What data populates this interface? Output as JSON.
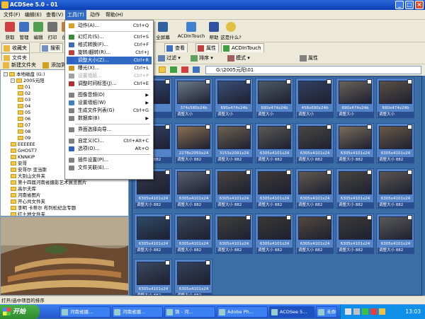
{
  "window": {
    "title": "ACDSee 5.0 - 01"
  },
  "menubar": [
    "文件(F)",
    "编辑(E)",
    "查看(V)",
    "工具(T)",
    "动作",
    "帮助(H)"
  ],
  "toolbar": [
    "获取",
    "管理",
    "编辑",
    "打印",
    "创建",
    "全屏幕",
    "ACDInTouch",
    "帮助",
    "这是什么?"
  ],
  "left": {
    "tabs": [
      "收藏夹",
      "搜索",
      "文件夹"
    ],
    "actions": [
      "新建文件夹",
      "添加到收"
    ],
    "tree": [
      {
        "label": "本地磁盘 (G:)",
        "indent": 0,
        "expand": "-"
      },
      {
        "label": "2005元阳",
        "indent": 1,
        "expand": "-"
      },
      {
        "label": "01",
        "indent": 2
      },
      {
        "label": "02",
        "indent": 2
      },
      {
        "label": "03",
        "indent": 2
      },
      {
        "label": "04",
        "indent": 2
      },
      {
        "label": "05",
        "indent": 2
      },
      {
        "label": "06",
        "indent": 2
      },
      {
        "label": "07",
        "indent": 2
      },
      {
        "label": "08",
        "indent": 2
      },
      {
        "label": "09",
        "indent": 2
      },
      {
        "label": "EEEEEE",
        "indent": 1
      },
      {
        "label": "GHOST7",
        "indent": 1
      },
      {
        "label": "KNNKIP",
        "indent": 1
      },
      {
        "label": "安哥",
        "indent": 1
      },
      {
        "label": "安哥尔 亚当斯",
        "indent": 1
      },
      {
        "label": "大别山文件夹",
        "indent": 1
      },
      {
        "label": "第十四届河南省摄影艺术展览图片",
        "indent": 1
      },
      {
        "label": "高尔夫库",
        "indent": 1
      },
      {
        "label": "河南省图片",
        "indent": 1
      },
      {
        "label": "开心共文件夹",
        "indent": 1
      },
      {
        "label": "李明 卡蒂尔 布列松纪念专题",
        "indent": 1
      },
      {
        "label": "红土地文件夹",
        "indent": 1
      }
    ]
  },
  "right": {
    "tabs": [
      "查看",
      "属性",
      "ACDInTouch"
    ],
    "toolbar": [
      "过滤",
      "排序",
      "模式",
      "属性"
    ],
    "address": "G:\\2005元阳\\01"
  },
  "tools_menu": {
    "items": [
      {
        "label": "动作(A)...",
        "shortcut": "Ctrl+Q",
        "sep_after": true,
        "icon": "action-icon",
        "color": "#e0a020"
      },
      {
        "label": "幻灯片(S)...",
        "shortcut": "Ctrl+S",
        "icon": "slideshow-icon",
        "color": "#3a8a3a"
      },
      {
        "label": "格式转换(F)...",
        "shortcut": "Ctrl+F",
        "icon": "convert-icon",
        "color": "#406ab0"
      },
      {
        "label": "旋转/翻转(R)...",
        "shortcut": "Ctrl+J",
        "icon": "rotate-icon",
        "color": "#c04040"
      },
      {
        "label": "调整大小(Z)...",
        "shortcut": "Ctrl+R",
        "selected": true,
        "icon": "resize-icon",
        "color": "#3060c0"
      },
      {
        "label": "曝光(X)...",
        "shortcut": "Ctrl+L",
        "icon": "exposure-icon",
        "color": "#d09020"
      },
      {
        "label": "设置墙纸...",
        "shortcut": "Ctrl+P",
        "disabled": true,
        "icon": "wallpaper-icon",
        "color": "#a0a0a0"
      },
      {
        "label": "调整时间标签(J)...",
        "shortcut": "Ctrl+E",
        "sep_after": true,
        "icon": "timestamp-icon",
        "color": "#b03030"
      },
      {
        "label": "图像音频(D)",
        "arrow": "▶",
        "icon": "audio-icon",
        "color": "#808080"
      },
      {
        "label": "设置墙纸(W)",
        "arrow": "▶",
        "icon": "wallpaper-icon",
        "color": "#4080c0"
      },
      {
        "label": "生成文件列表(G)",
        "shortcut": "Ctrl+G",
        "icon": "filelist-icon",
        "color": "#808080"
      },
      {
        "label": "数据库(B)",
        "arrow": "▶",
        "sep_after": true,
        "icon": "database-icon",
        "color": "#808080"
      },
      {
        "label": "界面选择向导...",
        "sep_after": true,
        "icon": "wizard-icon",
        "color": "#808080"
      },
      {
        "label": "自定义(C)...",
        "shortcut": "Ctrl+Alt+C",
        "icon": "customize-icon",
        "color": "#808080"
      },
      {
        "label": "选项(O)...",
        "shortcut": "Alt+O",
        "sep_after": true,
        "icon": "options-icon",
        "color": "#3060c0"
      },
      {
        "label": "插件设置(P)...",
        "icon": "plugin-icon",
        "color": "#808080"
      },
      {
        "label": "文件关联(E)...",
        "icon": "association-icon",
        "color": "#808080"
      }
    ]
  },
  "thumbnails": [
    {
      "cap1": "",
      "cap2": "调整大小",
      "tone": "#2f4a7a"
    },
    {
      "cap1": "374x580x24b",
      "cap2": "调整大小",
      "tone": "#6a7a8a"
    },
    {
      "cap1": "690x474x24b",
      "cap2": "调整大小",
      "tone": "#3a4f78"
    },
    {
      "cap1": "690x474x24b",
      "cap2": "调整大小",
      "tone": "#4e5a66"
    },
    {
      "cap1": "458x690x24b",
      "cap2": "调整大小",
      "tone": "#324060"
    },
    {
      "cap1": "690x474x24b",
      "cap2": "调整大小",
      "tone": "#6a6258"
    },
    {
      "cap1": "690x474x24b",
      "cap2": "调整大小",
      "tone": "#5a5044"
    },
    {
      "cap1": "",
      "cap2": "调整大小 882",
      "tone": "#334466"
    },
    {
      "cap1": "2278x2050x24",
      "cap2": "调整大小 882",
      "tone": "#8a7052"
    },
    {
      "cap1": "3153x2091x24",
      "cap2": "调整大小 882",
      "tone": "#6e6250"
    },
    {
      "cap1": "6305x4101x24",
      "cap2": "调整大小 882",
      "tone": "#5c5a56"
    },
    {
      "cap1": "6305x4101x24",
      "cap2": "调整大小 882",
      "tone": "#4a4842"
    },
    {
      "cap1": "6305x4101x24",
      "cap2": "调整大小 882",
      "tone": "#7a6c58"
    },
    {
      "cap1": "6305x4101x24",
      "cap2": "调整大小 882",
      "tone": "#6a5a48"
    },
    {
      "cap1": "6305x4101x24",
      "cap2": "调整大小 882",
      "tone": "#343848"
    },
    {
      "cap1": "6305x4101x24",
      "cap2": "调整大小 882",
      "tone": "#586070"
    },
    {
      "cap1": "6305x4101x24",
      "cap2": "调整大小 882",
      "tone": "#4a4440"
    },
    {
      "cap1": "6305x4101x24",
      "cap2": "调整大小 882",
      "tone": "#3e3a36"
    },
    {
      "cap1": "6305x4101x24",
      "cap2": "调整大小 882",
      "tone": "#625a50"
    },
    {
      "cap1": "6305x4101x24",
      "cap2": "调整大小 882",
      "tone": "#48463e"
    },
    {
      "cap1": "6305x4101x24",
      "cap2": "调整大小 882",
      "tone": "#5a5650"
    },
    {
      "cap1": "6305x4101x24",
      "cap2": "调整大小 882",
      "tone": "#2e4a66"
    },
    {
      "cap1": "6305x4101x24",
      "cap2": "调整大小 882",
      "tone": "#38465a"
    },
    {
      "cap1": "6305x4101x24",
      "cap2": "调整大小 882",
      "tone": "#40403c"
    },
    {
      "cap1": "6305x4101x24",
      "cap2": "调整大小 882",
      "tone": "#3a3834"
    },
    {
      "cap1": "6305x4101x24",
      "cap2": "调整大小 882",
      "tone": "#52483c"
    },
    {
      "cap1": "6305x4101x24",
      "cap2": "调整大小 882",
      "tone": "#3c3a38"
    },
    {
      "cap1": "6305x4101x24",
      "cap2": "调整大小 882",
      "tone": "#5a5a58"
    },
    {
      "cap1": "6305x4101x24",
      "cap2": "调整大小 882",
      "tone": "#3a4a60"
    },
    {
      "cap1": "6305x4101x24",
      "cap2": "调整大小 882",
      "tone": "#34425a"
    }
  ],
  "status": {
    "text": "打开/选中项目的排序"
  },
  "taskbar": {
    "start": "开始",
    "tasks": [
      "河南省摄...",
      "河南省摄...",
      "铸 - 河...",
      "Adobe Ph...",
      "ACDSee 5...",
      "未命名 -..."
    ],
    "active_task": 4,
    "clock": "13:03"
  }
}
